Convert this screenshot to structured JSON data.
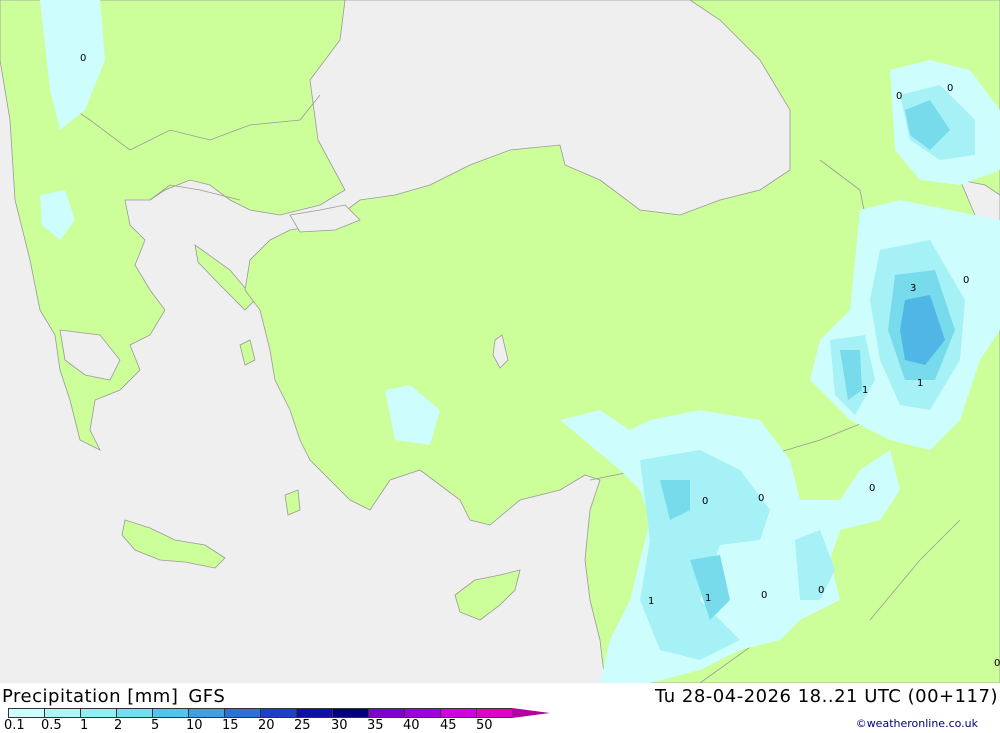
{
  "header": {
    "title": "Precipitation [mm]",
    "model": "GFS",
    "timestamp": "Tu 28-04-2026 18..21 UTC (00+117)"
  },
  "legend": {
    "ticks": [
      "0.1",
      "0.5",
      "1",
      "2",
      "5",
      "10",
      "15",
      "20",
      "25",
      "30",
      "35",
      "40",
      "45",
      "50"
    ],
    "colors": [
      "#cfffff",
      "#b0f4f8",
      "#8ff0f2",
      "#6fe0ee",
      "#4fc7e8",
      "#3f9fe0",
      "#2f6fd8",
      "#1f3fc8",
      "#1010a8",
      "#000080",
      "#8000d0",
      "#a000e0",
      "#d000e0",
      "#e000c8",
      "#b3009f"
    ]
  },
  "map": {
    "colors": {
      "sea": "#efefef",
      "land": "#ccff99",
      "border": "#999999",
      "precip_light": "#cdfdfd",
      "precip_mid": "#a6f1f6",
      "precip_strong": "#77dbec",
      "precip_heavy": "#4fb6e6"
    },
    "value_labels": [
      "0",
      "0",
      "0",
      "0",
      "3",
      "1",
      "1",
      "0",
      "0",
      "0",
      "1",
      "1",
      "0",
      "0",
      "0"
    ]
  },
  "copyright": "©weatheronline.co.uk"
}
